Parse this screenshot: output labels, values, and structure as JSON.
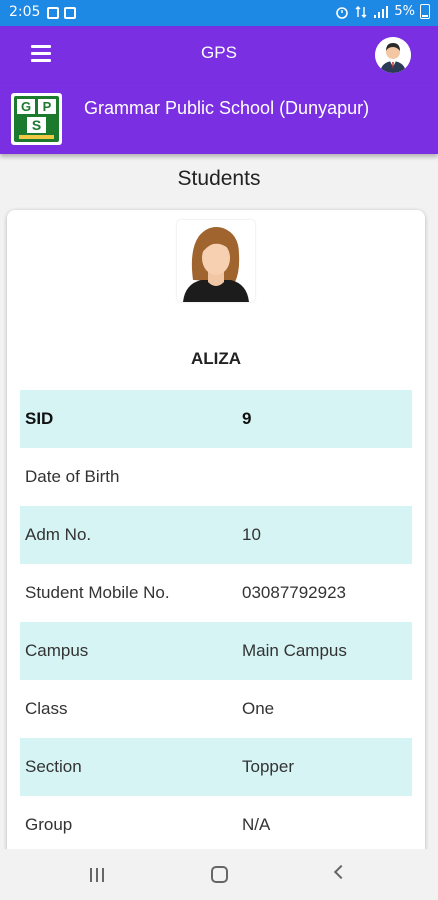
{
  "status_bar": {
    "time": "2:05",
    "battery": "5%",
    "icons": [
      "image-icon",
      "message-icon",
      "alarm-icon",
      "data-icon",
      "signal-icon",
      "battery-icon"
    ]
  },
  "app_bar": {
    "title": "GPS",
    "menu_icon": "hamburger-menu-icon",
    "avatar_icon": "user-avatar-icon"
  },
  "school": {
    "name": "Grammar Public School (Dunyapur)",
    "logo_letters": "GPS"
  },
  "page": {
    "title": "Students"
  },
  "student": {
    "name": "ALIZA",
    "photo_icon": "female-avatar-icon",
    "fields": [
      {
        "label": "SID",
        "value": "9"
      },
      {
        "label": "Date of Birth",
        "value": ""
      },
      {
        "label": "Adm No.",
        "value": "10"
      },
      {
        "label": "Student Mobile No.",
        "value": "03087792923"
      },
      {
        "label": "Campus",
        "value": "Main Campus"
      },
      {
        "label": "Class",
        "value": "One"
      },
      {
        "label": "Section",
        "value": "Topper"
      },
      {
        "label": "Group",
        "value": "N/A"
      }
    ]
  },
  "colors": {
    "status_bar": "#1e88e5",
    "app_bar": "#7b2fe3",
    "row_shade": "#d6f4f4"
  },
  "nav_bar": {
    "icons": [
      "recent-apps-icon",
      "home-icon",
      "back-icon"
    ]
  }
}
